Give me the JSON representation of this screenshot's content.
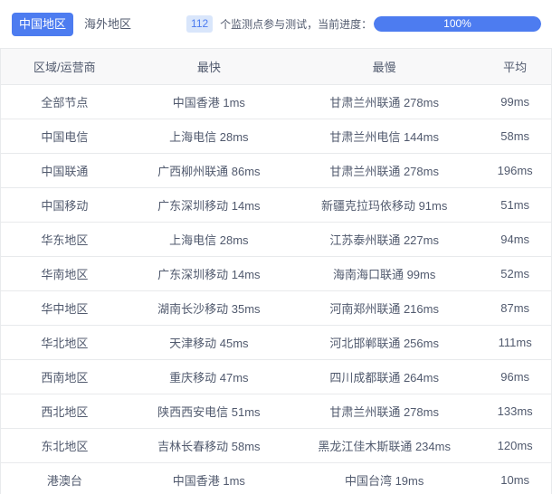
{
  "colors": {
    "accent": "#4d7cf0",
    "badge_bg": "#d9e6fb",
    "header_bg": "#f8f8f9",
    "border": "#e8eaec",
    "text": "#515a6e",
    "progress_track": "#f3f3f3"
  },
  "tabs": {
    "china": "中国地区",
    "overseas": "海外地区"
  },
  "status": {
    "count": "112",
    "label": "个监测点参与测试，当前进度：",
    "progress_percent": 100,
    "progress_label": "100%"
  },
  "table": {
    "headers": [
      "区域/运营商",
      "最快",
      "最慢",
      "平均"
    ],
    "rows": [
      [
        "全部节点",
        "中国香港 1ms",
        "甘肃兰州联通 278ms",
        "99ms"
      ],
      [
        "中国电信",
        "上海电信 28ms",
        "甘肃兰州电信 144ms",
        "58ms"
      ],
      [
        "中国联通",
        "广西柳州联通 86ms",
        "甘肃兰州联通 278ms",
        "196ms"
      ],
      [
        "中国移动",
        "广东深圳移动 14ms",
        "新疆克拉玛依移动 91ms",
        "51ms"
      ],
      [
        "华东地区",
        "上海电信 28ms",
        "江苏泰州联通 227ms",
        "94ms"
      ],
      [
        "华南地区",
        "广东深圳移动 14ms",
        "海南海口联通 99ms",
        "52ms"
      ],
      [
        "华中地区",
        "湖南长沙移动 35ms",
        "河南郑州联通 216ms",
        "87ms"
      ],
      [
        "华北地区",
        "天津移动 45ms",
        "河北邯郸联通 256ms",
        "111ms"
      ],
      [
        "西南地区",
        "重庆移动 47ms",
        "四川成都联通 264ms",
        "96ms"
      ],
      [
        "西北地区",
        "陕西西安电信 51ms",
        "甘肃兰州联通 278ms",
        "133ms"
      ],
      [
        "东北地区",
        "吉林长春移动 58ms",
        "黑龙江佳木斯联通 234ms",
        "120ms"
      ],
      [
        "港澳台",
        "中国香港 1ms",
        "中国台湾 19ms",
        "10ms"
      ]
    ]
  }
}
